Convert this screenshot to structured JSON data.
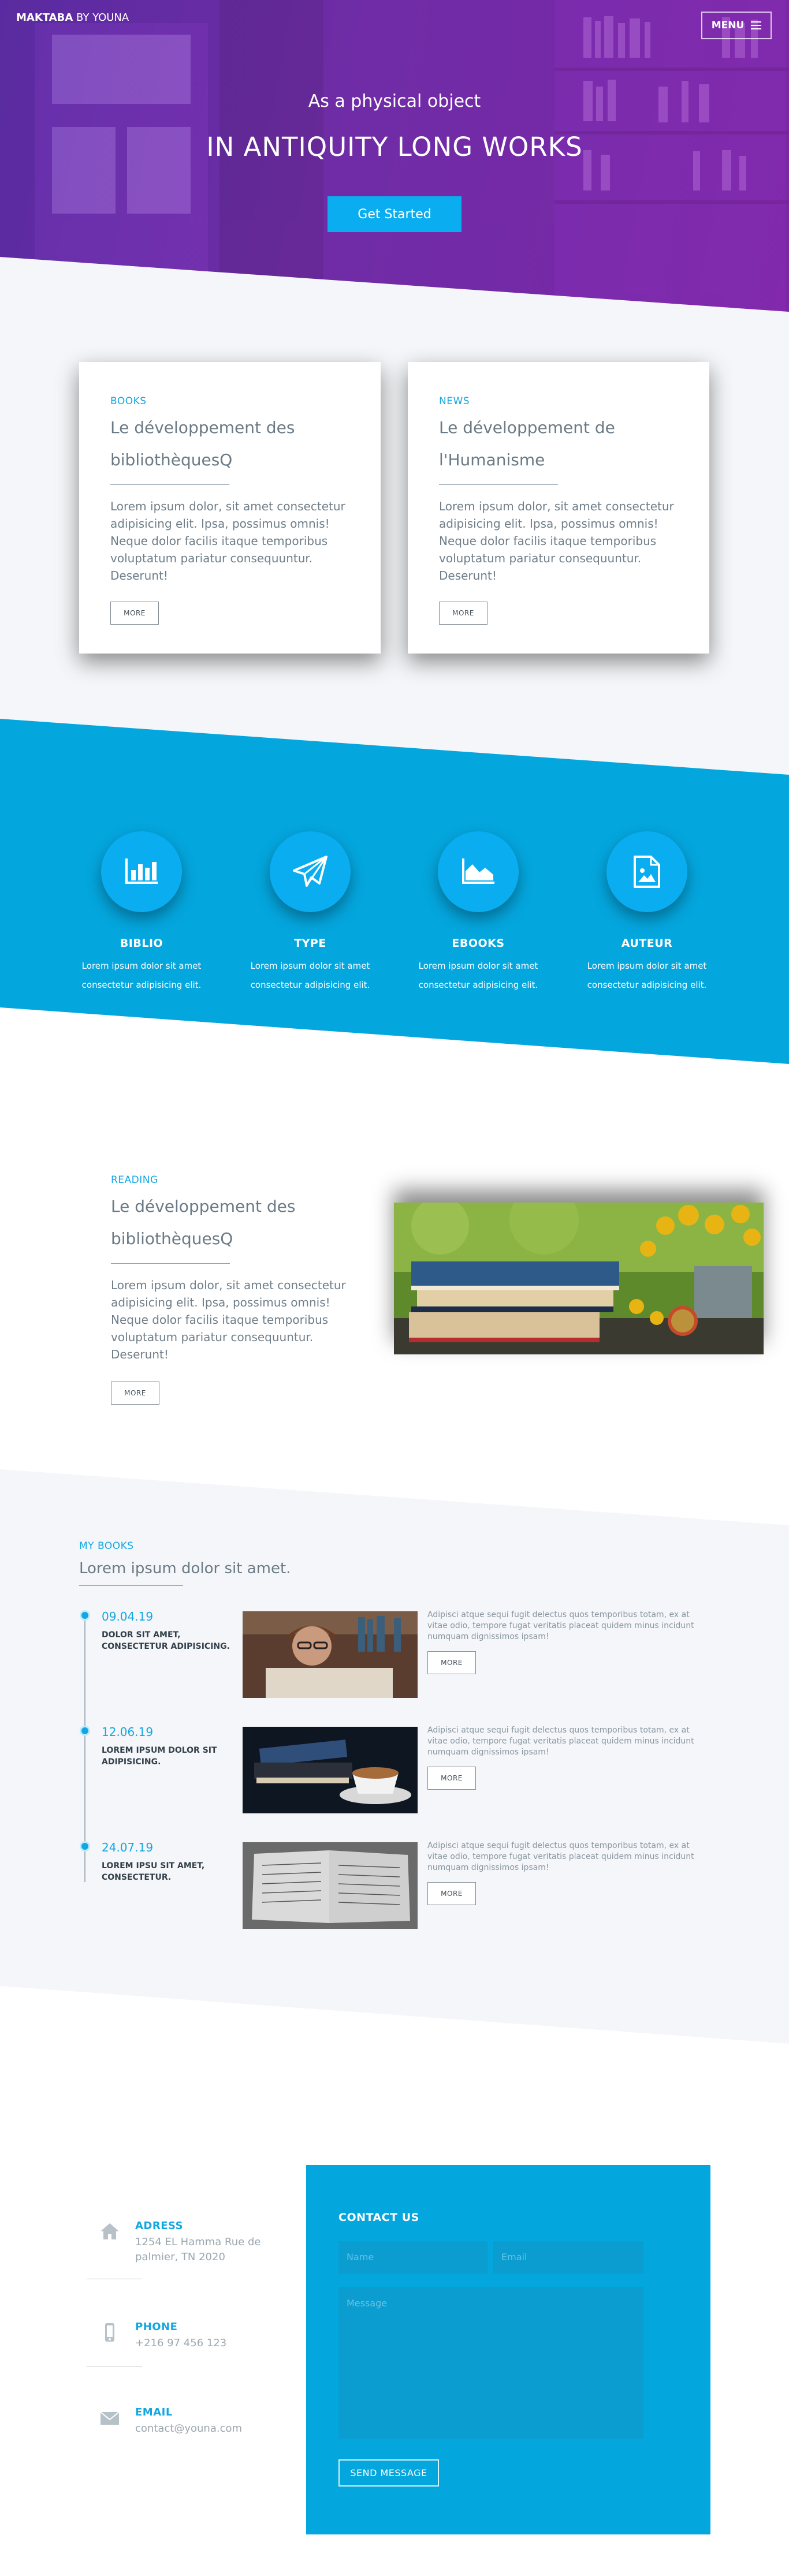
{
  "header": {
    "brand_bold": "MAKTABA",
    "brand_rest": " BY YOUNA",
    "menu_label": "MENU"
  },
  "hero": {
    "subtitle": "As a physical object",
    "title": "IN ANTIQUITY LONG WORKS",
    "cta": "Get Started"
  },
  "cards": [
    {
      "eyebrow": "BOOKS",
      "title": "Le développement des bibliothèquesQ",
      "text": "Lorem ipsum dolor, sit amet consectetur adipisicing elit. Ipsa, possimus omnis! Neque dolor facilis itaque temporibus voluptatum pariatur consequuntur. Deserunt!",
      "button": "MORE"
    },
    {
      "eyebrow": "NEWS",
      "title": "Le développement de l'Humanisme",
      "text": "Lorem ipsum dolor, sit amet consectetur adipisicing elit. Ipsa, possimus omnis! Neque dolor facilis itaque temporibus voluptatum pariatur consequuntur. Deserunt!",
      "button": "MORE"
    }
  ],
  "features": [
    {
      "icon": "bar-chart-icon",
      "title": "BIBLIO",
      "text": "Lorem ipsum dolor sit amet consectetur adipisicing elit."
    },
    {
      "icon": "paper-plane-icon",
      "title": "TYPE",
      "text": "Lorem ipsum dolor sit amet consectetur adipisicing elit."
    },
    {
      "icon": "area-chart-icon",
      "title": "EBOOKS",
      "text": "Lorem ipsum dolor sit amet consectetur adipisicing elit."
    },
    {
      "icon": "image-file-icon",
      "title": "AUTEUR",
      "text": "Lorem ipsum dolor sit amet consectetur adipisicing elit."
    }
  ],
  "reading": {
    "eyebrow": "READING",
    "title": "Le développement des bibliothèquesQ",
    "text": "Lorem ipsum dolor, sit amet consectetur adipisicing elit. Ipsa, possimus omnis! Neque dolor facilis itaque temporibus voluptatum pariatur consequuntur. Deserunt!",
    "button": "MORE"
  },
  "my_books": {
    "eyebrow": "MY BOOKS",
    "title": "Lorem ipsum dolor sit amet.",
    "entries": [
      {
        "date": "09.04.19",
        "label": "DOLOR SIT AMET, CONSECTETUR ADIPISICING.",
        "text": "Adipisci atque sequi fugit delectus quos temporibus totam, ex at vitae odio, tempore fugat veritatis placeat quidem minus incidunt numquam dignissimos ipsam!",
        "button": "MORE"
      },
      {
        "date": "12.06.19",
        "label": "LOREM IPSUM DOLOR SIT ADIPISICING.",
        "text": "Adipisci atque sequi fugit delectus quos temporibus totam, ex at vitae odio, tempore fugat veritatis placeat quidem minus incidunt numquam dignissimos ipsam!",
        "button": "MORE"
      },
      {
        "date": "24.07.19",
        "label": "LOREM IPSU SIT AMET, CONSECTETUR.",
        "text": "Adipisci atque sequi fugit delectus quos temporibus totam, ex at vitae odio, tempore fugat veritatis placeat quidem minus incidunt numquam dignissimos ipsam!",
        "button": "MORE"
      }
    ]
  },
  "contact_info": [
    {
      "icon": "home-icon",
      "title": "ADRESS",
      "value": "1254 EL Hamma Rue de palmier, TN 2020"
    },
    {
      "icon": "phone-icon",
      "title": "PHONE",
      "value": "+216 97 456 123"
    },
    {
      "icon": "envelope-icon",
      "title": "EMAIL",
      "value": "contact@youna.com"
    }
  ],
  "contact_form": {
    "title": "CONTACT US",
    "name_placeholder": "Name",
    "email_placeholder": "Email",
    "message_placeholder": "Message",
    "button": "SEND MESSAGE"
  },
  "colors": {
    "accent": "#04a6de",
    "hero_purple": "#8a35c0"
  }
}
